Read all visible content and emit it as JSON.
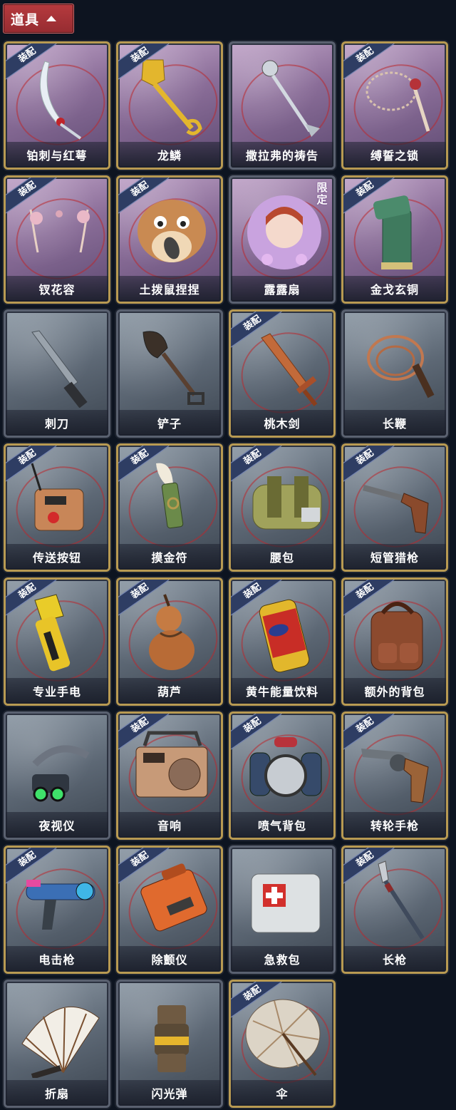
{
  "header": {
    "label": "道具"
  },
  "equip_badge": "装配",
  "items": [
    {
      "name": "铂刺与红萼",
      "style": "purple",
      "equip": true,
      "icon": "curved-blade-icon"
    },
    {
      "name": "龙鳞",
      "style": "purple",
      "equip": true,
      "icon": "gold-shovel-icon"
    },
    {
      "name": "撒拉弗的祷告",
      "style": "purple",
      "equip": false,
      "icon": "silver-staff-icon"
    },
    {
      "name": "缚誓之锁",
      "style": "purple",
      "equip": true,
      "icon": "chain-flail-icon"
    },
    {
      "name": "钗花容",
      "style": "purple",
      "equip": true,
      "icon": "hair-pin-icon"
    },
    {
      "name": "土拨鼠捏捏",
      "style": "purple",
      "equip": true,
      "icon": "groundhog-plush-icon"
    },
    {
      "name": "露露扇",
      "style": "purple",
      "equip": false,
      "icon": "anime-girl-fan-icon",
      "limited": "限定"
    },
    {
      "name": "金戈玄铜",
      "style": "purple",
      "equip": true,
      "icon": "bronze-pillar-icon"
    },
    {
      "name": "刺刀",
      "style": "gray",
      "equip": false,
      "icon": "bayonet-icon"
    },
    {
      "name": "铲子",
      "style": "gray",
      "equip": false,
      "icon": "shovel-icon"
    },
    {
      "name": "桃木剑",
      "style": "gray",
      "equip": true,
      "icon": "wooden-sword-icon"
    },
    {
      "name": "长鞭",
      "style": "gray",
      "equip": false,
      "icon": "whip-icon"
    },
    {
      "name": "传送按钮",
      "style": "gray",
      "equip": true,
      "icon": "teleport-button-icon"
    },
    {
      "name": "摸金符",
      "style": "gray",
      "equip": true,
      "icon": "tooth-amulet-icon"
    },
    {
      "name": "腰包",
      "style": "gray",
      "equip": true,
      "icon": "waist-bag-icon"
    },
    {
      "name": "短管猎枪",
      "style": "gray",
      "equip": true,
      "icon": "shotgun-icon"
    },
    {
      "name": "专业手电",
      "style": "gray",
      "equip": true,
      "icon": "flashlight-icon"
    },
    {
      "name": "葫芦",
      "style": "gray",
      "equip": true,
      "icon": "gourd-icon"
    },
    {
      "name": "黄牛能量饮料",
      "style": "gray",
      "equip": true,
      "icon": "energy-drink-icon"
    },
    {
      "name": "额外的背包",
      "style": "gray",
      "equip": true,
      "icon": "backpack-icon"
    },
    {
      "name": "夜视仪",
      "style": "gray",
      "equip": false,
      "icon": "night-vision-icon"
    },
    {
      "name": "音响",
      "style": "gray",
      "equip": true,
      "icon": "radio-speaker-icon"
    },
    {
      "name": "喷气背包",
      "style": "gray",
      "equip": true,
      "icon": "jetpack-icon"
    },
    {
      "name": "转轮手枪",
      "style": "gray",
      "equip": true,
      "icon": "revolver-icon"
    },
    {
      "name": "电击枪",
      "style": "gray",
      "equip": true,
      "icon": "stun-gun-icon"
    },
    {
      "name": "除颤仪",
      "style": "gray",
      "equip": true,
      "icon": "defibrillator-icon"
    },
    {
      "name": "急救包",
      "style": "gray",
      "equip": false,
      "icon": "first-aid-kit-icon"
    },
    {
      "name": "长枪",
      "style": "gray",
      "equip": true,
      "icon": "spear-icon"
    },
    {
      "name": "折扇",
      "style": "gray",
      "equip": false,
      "icon": "folding-fan-icon"
    },
    {
      "name": "闪光弹",
      "style": "gray",
      "equip": false,
      "icon": "flashbang-icon"
    },
    {
      "name": "伞",
      "style": "gray",
      "equip": true,
      "icon": "umbrella-icon"
    }
  ]
}
